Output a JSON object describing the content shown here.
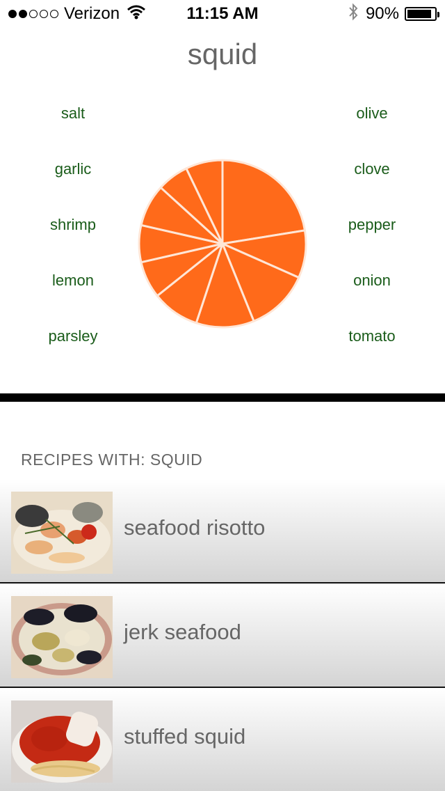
{
  "status_bar": {
    "carrier": "Verizon",
    "time": "11:15 AM",
    "battery": "90%",
    "battery_level": 0.9,
    "signal_bars_filled": 2,
    "signal_bars_total": 5
  },
  "title": "squid",
  "ingredients": {
    "left": [
      "salt",
      "garlic",
      "shrimp",
      "lemon",
      "parsley"
    ],
    "right": [
      "olive",
      "clove",
      "pepper",
      "onion",
      "tomato"
    ]
  },
  "chart_data": {
    "type": "pie",
    "slice_color": "#ff6a1a",
    "separator_color": "#ffe6d6",
    "values": [
      22,
      9,
      12,
      11,
      9,
      7,
      7,
      8,
      6,
      7
    ]
  },
  "recipes_header": "RECIPES WITH: SQUID",
  "recipes": [
    {
      "name": "seafood risotto",
      "thumb": "seafood-risotto-photo"
    },
    {
      "name": "jerk seafood",
      "thumb": "jerk-seafood-photo"
    },
    {
      "name": "stuffed squid",
      "thumb": "stuffed-squid-photo"
    }
  ],
  "colors": {
    "accent": "#ff6a1a",
    "ingredient_text": "#1a5c1a",
    "title_text": "#666666"
  }
}
